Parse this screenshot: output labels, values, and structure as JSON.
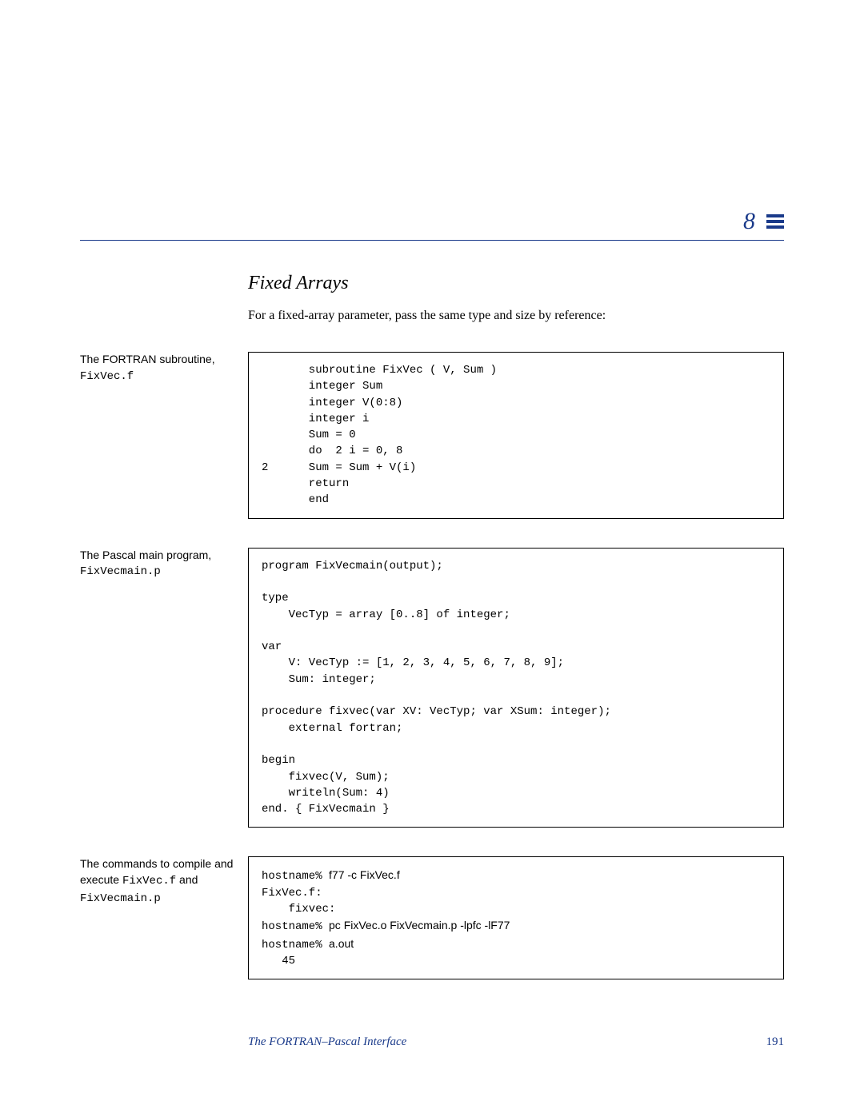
{
  "chapter_number": "8",
  "section_title": "Fixed Arrays",
  "intro_text": "For a fixed-array parameter, pass the same type and size by reference:",
  "block1": {
    "caption_text": "The FORTRAN subroutine,",
    "caption_file": "FixVec.f",
    "code": "       subroutine FixVec ( V, Sum )\n       integer Sum\n       integer V(0:8)\n       integer i\n       Sum = 0\n       do  2 i = 0, 8\n2      Sum = Sum + V(i)\n       return\n       end"
  },
  "block2": {
    "caption_text": "The Pascal main program,",
    "caption_file": "FixVecmain.p",
    "code": "program FixVecmain(output);\n\ntype\n    VecTyp = array [0..8] of integer;\n\nvar\n    V: VecTyp := [1, 2, 3, 4, 5, 6, 7, 8, 9];\n    Sum: integer;\n\nprocedure fixvec(var XV: VecTyp; var XSum: integer);\n    external fortran;\n\nbegin\n    fixvec(V, Sum);\n    writeln(Sum: 4)\nend. { FixVecmain }"
  },
  "block3": {
    "caption_line1": "The commands to compile and",
    "caption_line2_a": "execute ",
    "caption_line2_b": "FixVec.f",
    "caption_line2_c": " and",
    "caption_line3": "FixVecmain.p",
    "code_l1a": "hostname% ",
    "code_l1b": "f77 -c FixVec.f",
    "code_l2": "FixVec.f:",
    "code_l3": "    fixvec:",
    "code_l4a": "hostname% ",
    "code_l4b": "pc FixVec.o FixVecmain.p -lpfc -lF77",
    "code_l5a": "hostname% ",
    "code_l5b": "a.out",
    "code_l6": "   45"
  },
  "footer": {
    "title": "The FORTRAN–Pascal Interface",
    "page": "191"
  }
}
